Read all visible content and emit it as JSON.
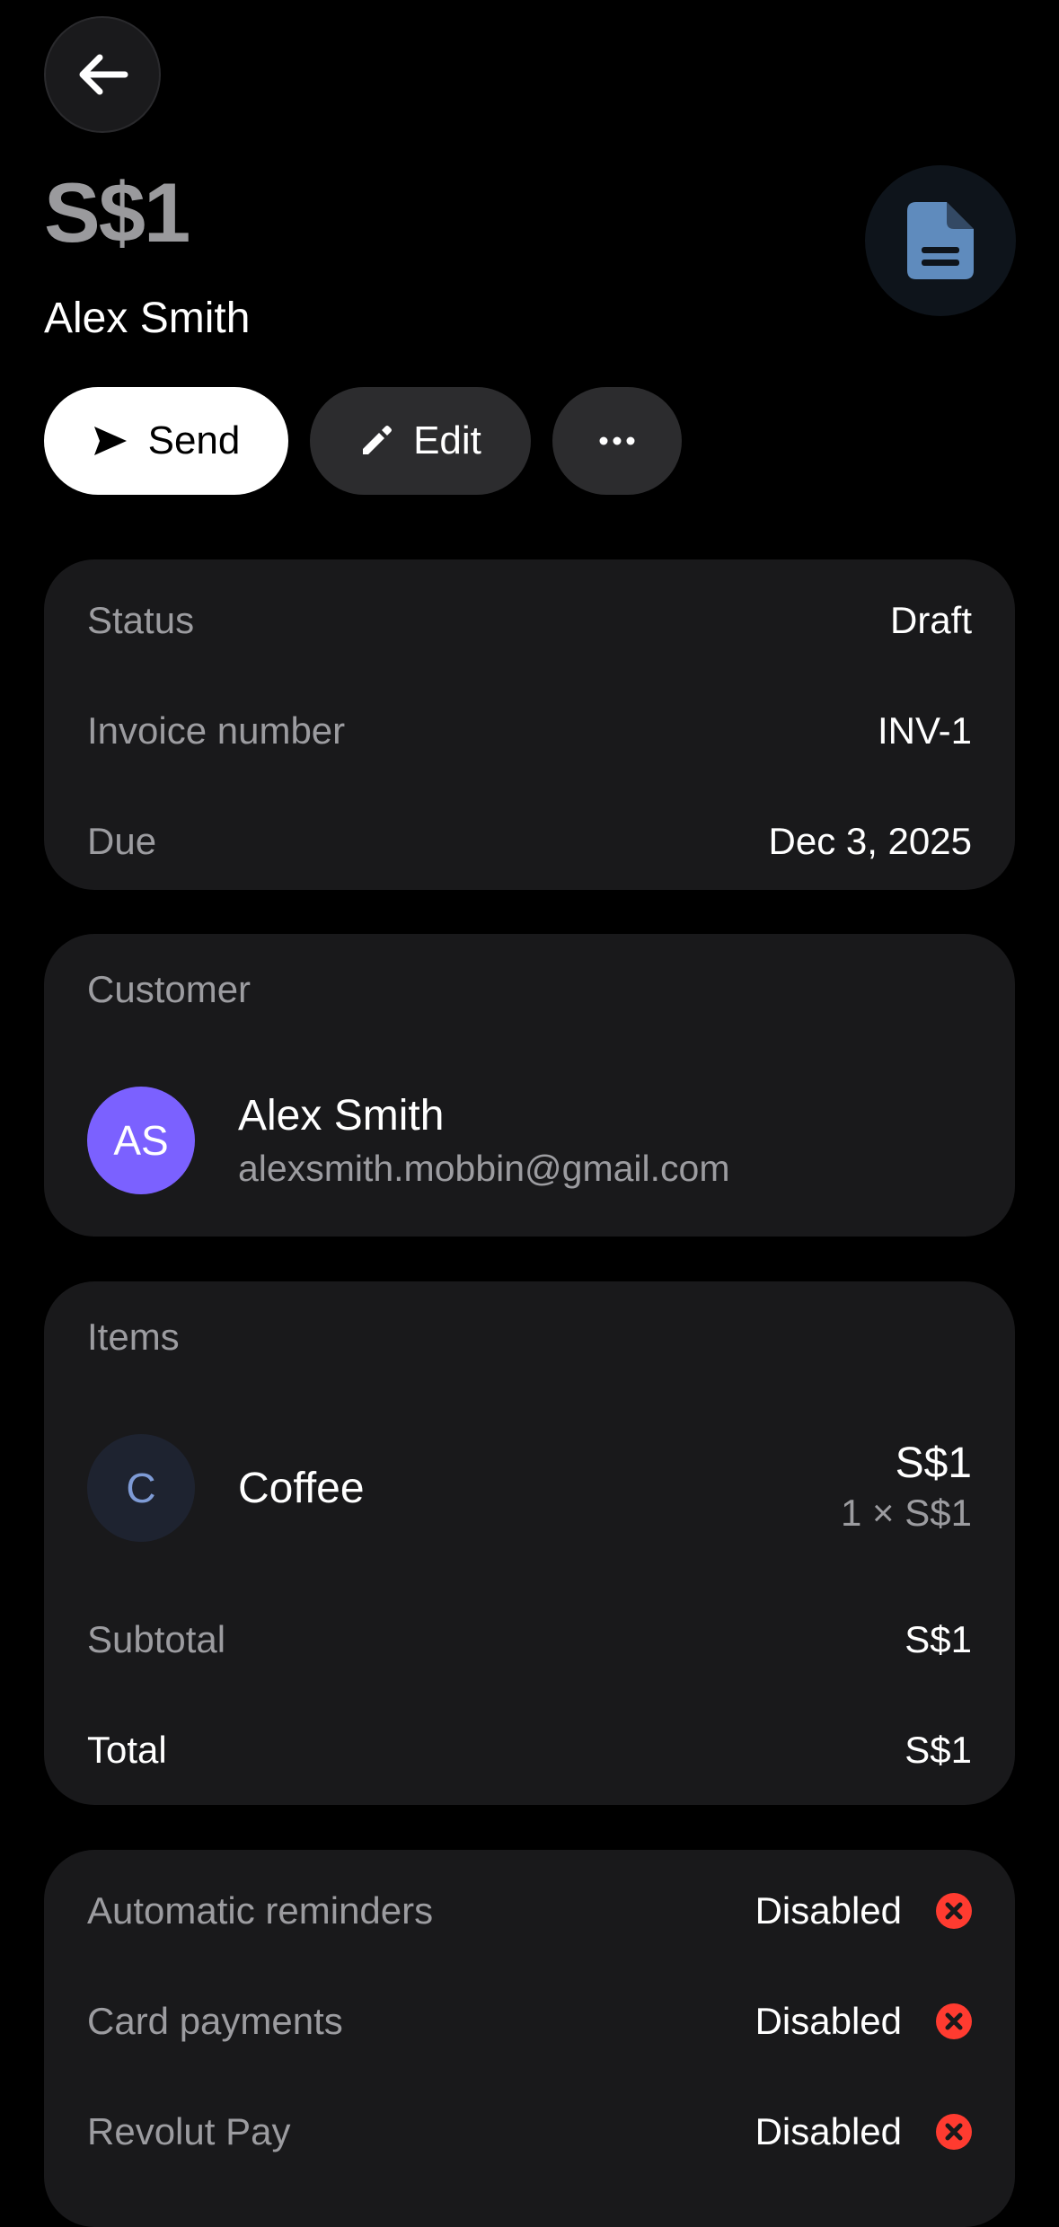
{
  "header": {
    "amount": "S$1",
    "customer_name": "Alex Smith"
  },
  "actions": {
    "send_label": "Send",
    "edit_label": "Edit"
  },
  "details": {
    "status_label": "Status",
    "status_value": "Draft",
    "invoice_label": "Invoice number",
    "invoice_value": "INV-1",
    "due_label": "Due",
    "due_value": "Dec 3, 2025"
  },
  "customer": {
    "section_title": "Customer",
    "initials": "AS",
    "name": "Alex Smith",
    "email": "alexsmith.mobbin@gmail.com",
    "avatar_color": "#7b61ff"
  },
  "items": {
    "section_title": "Items",
    "list": [
      {
        "initial": "C",
        "name": "Coffee",
        "total": "S$1",
        "breakdown": "1 × S$1"
      }
    ],
    "subtotal_label": "Subtotal",
    "subtotal_value": "S$1",
    "total_label": "Total",
    "total_value": "S$1"
  },
  "settings": [
    {
      "label": "Automatic reminders",
      "value": "Disabled"
    },
    {
      "label": "Card payments",
      "value": "Disabled"
    },
    {
      "label": "Revolut Pay",
      "value": "Disabled"
    }
  ],
  "colors": {
    "background": "#000000",
    "card": "#19191b",
    "disabled_icon": "#ff3b30",
    "doc_icon": "#5f8bbd"
  },
  "icons": {
    "back": "arrow-left-icon",
    "document": "document-icon",
    "send": "paper-plane-icon",
    "edit": "pencil-icon",
    "more": "ellipsis-icon",
    "disabled": "x-circle-icon"
  }
}
